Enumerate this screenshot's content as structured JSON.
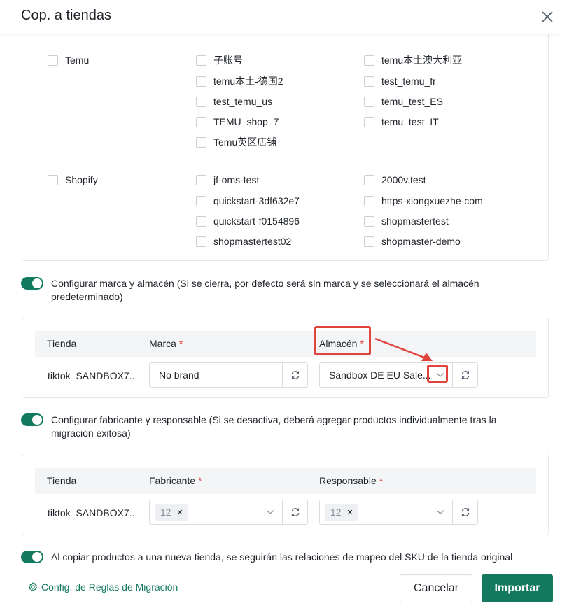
{
  "dialog": {
    "title": "Cop. a tiendas"
  },
  "platforms": [
    {
      "label": "Temu",
      "shops": [
        "子账号",
        "temu本土澳大利亚",
        "temu本土-德国2",
        "test_temu_fr",
        "test_temu_us",
        "temu_test_ES",
        "TEMU_shop_7",
        "temu_test_IT",
        "Temu英区店铺"
      ]
    },
    {
      "label": "Shopify",
      "shops": [
        "jf-oms-test",
        "2000v.test",
        "quickstart-3df632e7",
        "https-xiongxuezhe-com",
        "quickstart-f0154896",
        "shopmastertest",
        "shopmastertest02",
        "shopmaster-demo"
      ]
    }
  ],
  "brand_section": {
    "toggle_text": "Configurar marca y almacén (Si se cierra, por defecto será sin marca y se seleccionará el almacén predeterminado)",
    "col_store": "Tienda",
    "col_brand": "Marca",
    "col_warehouse": "Almacén",
    "required_mark": "*",
    "row_store": "tiktok_SANDBOX7...",
    "brand_value": "No brand",
    "warehouse_value": "Sandbox DE EU Sale..."
  },
  "manufacturer_section": {
    "toggle_text": "Configurar fabricante y responsable (Si se desactiva, deberá agregar productos individualmente tras la migración exitosa)",
    "col_store": "Tienda",
    "col_manufacturer": "Fabricante",
    "col_responsible": "Responsable",
    "required_mark": "*",
    "row_store": "tiktok_SANDBOX7...",
    "manufacturer_tag": "12",
    "responsible_tag": "12"
  },
  "sku_toggle_text": "Al copiar productos a una nueva tienda, se seguirán las relaciones de mapeo del SKU de la tienda original",
  "footer": {
    "rules_link": "Config. de Reglas de Migración",
    "cancel_label": "Cancelar",
    "import_label": "Importar"
  },
  "colors": {
    "primary": "#137a5f",
    "highlight": "#e0443c"
  },
  "icons": [
    "close-icon",
    "refresh-icon",
    "chevron-down-icon",
    "gear-icon",
    "remove-tag-icon"
  ]
}
